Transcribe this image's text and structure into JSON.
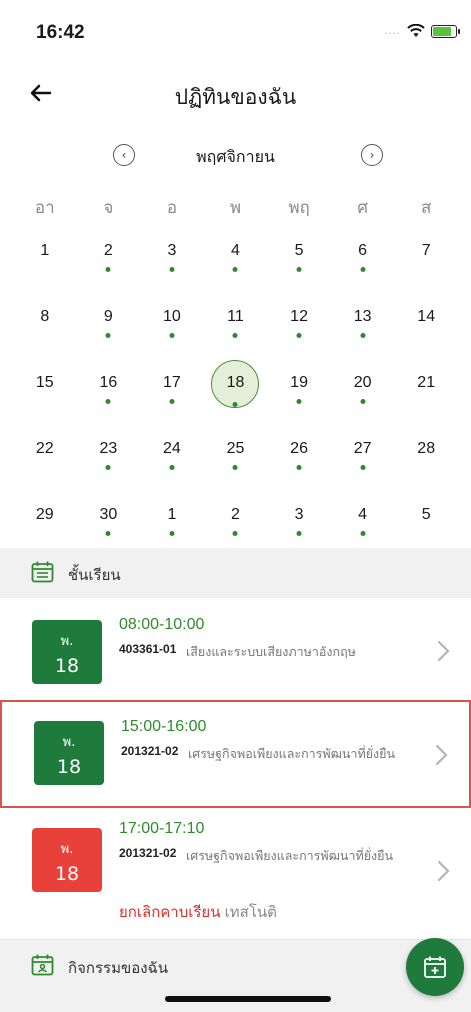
{
  "status_bar": {
    "time": "16:42",
    "signal": "....",
    "battery_color": "#5cc23a"
  },
  "header": {
    "title": "ปฏิทินของฉัน"
  },
  "calendar": {
    "month": "พฤศจิกายน",
    "weekdays": [
      "อา",
      "จ",
      "อ",
      "พ",
      "พฤ",
      "ศ",
      "ส"
    ],
    "weeks": [
      [
        {
          "d": "1",
          "dot": false
        },
        {
          "d": "2",
          "dot": true
        },
        {
          "d": "3",
          "dot": true
        },
        {
          "d": "4",
          "dot": true
        },
        {
          "d": "5",
          "dot": true
        },
        {
          "d": "6",
          "dot": true
        },
        {
          "d": "7",
          "dot": false
        }
      ],
      [
        {
          "d": "8",
          "dot": false
        },
        {
          "d": "9",
          "dot": true
        },
        {
          "d": "10",
          "dot": true
        },
        {
          "d": "11",
          "dot": true
        },
        {
          "d": "12",
          "dot": true
        },
        {
          "d": "13",
          "dot": true
        },
        {
          "d": "14",
          "dot": false
        }
      ],
      [
        {
          "d": "15",
          "dot": false
        },
        {
          "d": "16",
          "dot": true
        },
        {
          "d": "17",
          "dot": true
        },
        {
          "d": "18",
          "dot": true,
          "selected": true
        },
        {
          "d": "19",
          "dot": true
        },
        {
          "d": "20",
          "dot": true
        },
        {
          "d": "21",
          "dot": false
        }
      ],
      [
        {
          "d": "22",
          "dot": false
        },
        {
          "d": "23",
          "dot": true
        },
        {
          "d": "24",
          "dot": true
        },
        {
          "d": "25",
          "dot": true
        },
        {
          "d": "26",
          "dot": true
        },
        {
          "d": "27",
          "dot": true
        },
        {
          "d": "28",
          "dot": false
        }
      ],
      [
        {
          "d": "29",
          "dot": false
        },
        {
          "d": "30",
          "dot": true
        },
        {
          "d": "1",
          "dot": true
        },
        {
          "d": "2",
          "dot": true
        },
        {
          "d": "3",
          "dot": true
        },
        {
          "d": "4",
          "dot": true
        },
        {
          "d": "5",
          "dot": false
        }
      ]
    ]
  },
  "classes_section": {
    "label": "ชั้นเรียน"
  },
  "classes": [
    {
      "day": "พ.",
      "date": "18",
      "time": "08:00-10:00",
      "code": "403361-01",
      "name": "เสียงและระบบเสียงภาษาอังกฤษ"
    },
    {
      "day": "พ.",
      "date": "18",
      "time": "15:00-16:00",
      "code": "201321-02",
      "name": "เศรษฐกิจพอเพียงและการพัฒนาที่ยั่งยืน"
    },
    {
      "day": "พ.",
      "date": "18",
      "time": "17:00-17:10",
      "code": "201321-02",
      "name": "เศรษฐกิจพอเพียงและการพัฒนาที่ยั่งยืน",
      "cancel_label": "ยกเลิกคาบเรียน",
      "cancel_note": "เทสโนติ"
    }
  ],
  "activities_section": {
    "label": "กิจกรรมของฉัน"
  },
  "colors": {
    "primary_green": "#1e7b3b",
    "cancel_red": "#e8413a",
    "time_green": "#2e8b2e"
  }
}
